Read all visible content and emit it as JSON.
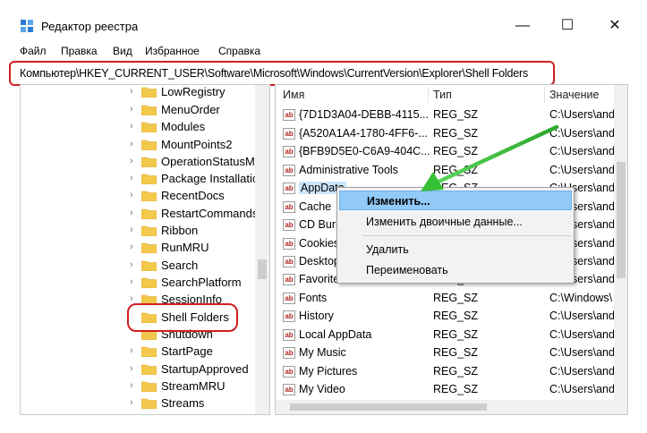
{
  "window": {
    "title": "Редактор реестра",
    "minimize": "—",
    "maximize": "☐",
    "close": "✕"
  },
  "menu": {
    "items": [
      "Файл",
      "Правка",
      "Вид",
      "Избранное",
      "Справка"
    ]
  },
  "address": {
    "path": "Компьютер\\HKEY_CURRENT_USER\\Software\\Microsoft\\Windows\\CurrentVersion\\Explorer\\Shell Folders"
  },
  "tree": {
    "items": [
      {
        "label": "LowRegistry"
      },
      {
        "label": "MenuOrder"
      },
      {
        "label": "Modules"
      },
      {
        "label": "MountPoints2"
      },
      {
        "label": "OperationStatusM"
      },
      {
        "label": "Package Installatic"
      },
      {
        "label": "RecentDocs"
      },
      {
        "label": "RestartCommands"
      },
      {
        "label": "Ribbon"
      },
      {
        "label": "RunMRU"
      },
      {
        "label": "Search"
      },
      {
        "label": "SearchPlatform"
      },
      {
        "label": "SessionInfo"
      },
      {
        "label": "Shell Folders"
      },
      {
        "label": "Shutdown"
      },
      {
        "label": "StartPage"
      },
      {
        "label": "StartupApproved"
      },
      {
        "label": "StreamMRU"
      },
      {
        "label": "Streams"
      }
    ]
  },
  "list": {
    "headers": {
      "name": "Имя",
      "type": "Тип",
      "value": "Значение"
    },
    "rows": [
      {
        "name": "{7D1D3A04-DEBB-4115...",
        "type": "REG_SZ",
        "value": "C:\\Users\\and"
      },
      {
        "name": "{A520A1A4-1780-4FF6-...",
        "type": "REG_SZ",
        "value": "C:\\Users\\and"
      },
      {
        "name": "{BFB9D5E0-C6A9-404C...",
        "type": "REG_SZ",
        "value": "C:\\Users\\and"
      },
      {
        "name": "Administrative Tools",
        "type": "REG_SZ",
        "value": "C:\\Users\\and"
      },
      {
        "name": "AppData",
        "type": "REG_SZ",
        "value": "C:\\Users\\and"
      },
      {
        "name": "Cache",
        "type": "REG_SZ",
        "value": "C:\\Users\\and"
      },
      {
        "name": "CD Burning",
        "type": "REG_SZ",
        "value": "C:\\Users\\and"
      },
      {
        "name": "Cookies",
        "type": "REG_SZ",
        "value": "C:\\Users\\and"
      },
      {
        "name": "Desktop",
        "type": "REG_SZ",
        "value": "C:\\Users\\and"
      },
      {
        "name": "Favorites",
        "type": "REG_SZ",
        "value": "C:\\Users\\and"
      },
      {
        "name": "Fonts",
        "type": "REG_SZ",
        "value": "C:\\Windows\\"
      },
      {
        "name": "History",
        "type": "REG_SZ",
        "value": "C:\\Users\\and"
      },
      {
        "name": "Local AppData",
        "type": "REG_SZ",
        "value": "C:\\Users\\and"
      },
      {
        "name": "My Music",
        "type": "REG_SZ",
        "value": "C:\\Users\\and"
      },
      {
        "name": "My Pictures",
        "type": "REG_SZ",
        "value": "C:\\Users\\and"
      },
      {
        "name": "My Video",
        "type": "REG_SZ",
        "value": "C:\\Users\\and"
      }
    ]
  },
  "context_menu": {
    "modify": "Изменить...",
    "modify_binary": "Изменить двоичные данные...",
    "delete": "Удалить",
    "rename": "Переименовать"
  },
  "colors": {
    "highlight_red": "#d11f1f",
    "arrow_green": "#2fc42f",
    "menu_hover": "#91c9f7"
  }
}
